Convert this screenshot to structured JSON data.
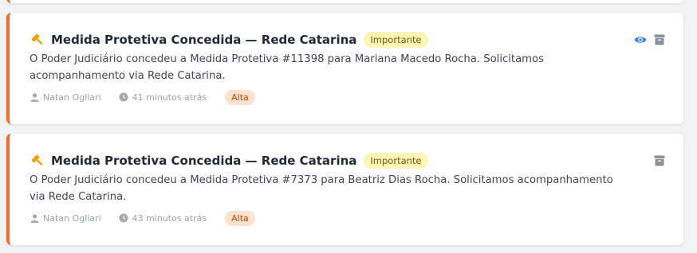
{
  "colors": {
    "accent_border": "#f06a28",
    "badge_important_bg": "#fdf5b5",
    "badge_high_bg": "#fde3cf",
    "eye_icon": "#3b82f6",
    "archive_icon": "#8a9099"
  },
  "notifications": [
    {
      "icon": "gavel-icon",
      "title": "Medida Protetiva Concedida — Rede Catarina",
      "tag": "Importante",
      "description": "O Poder Judiciário concedeu a Medida Protetiva #11398 para Mariana Macedo Rocha. Solicitamos acompanhamento via Rede Catarina.",
      "author": "Natan Ogliari",
      "time": "41 minutos atrás",
      "priority": "Alta",
      "actions": [
        "eye-icon",
        "archive-icon"
      ]
    },
    {
      "icon": "gavel-icon",
      "title": "Medida Protetiva Concedida — Rede Catarina",
      "tag": "Importante",
      "description": "O Poder Judiciário concedeu a Medida Protetiva #7373 para Beatriz Dias Rocha. Solicitamos acompanhamento via Rede Catarina.",
      "author": "Natan Ogliari",
      "time": "43 minutos atrás",
      "priority": "Alta",
      "actions": [
        "archive-icon"
      ]
    }
  ]
}
